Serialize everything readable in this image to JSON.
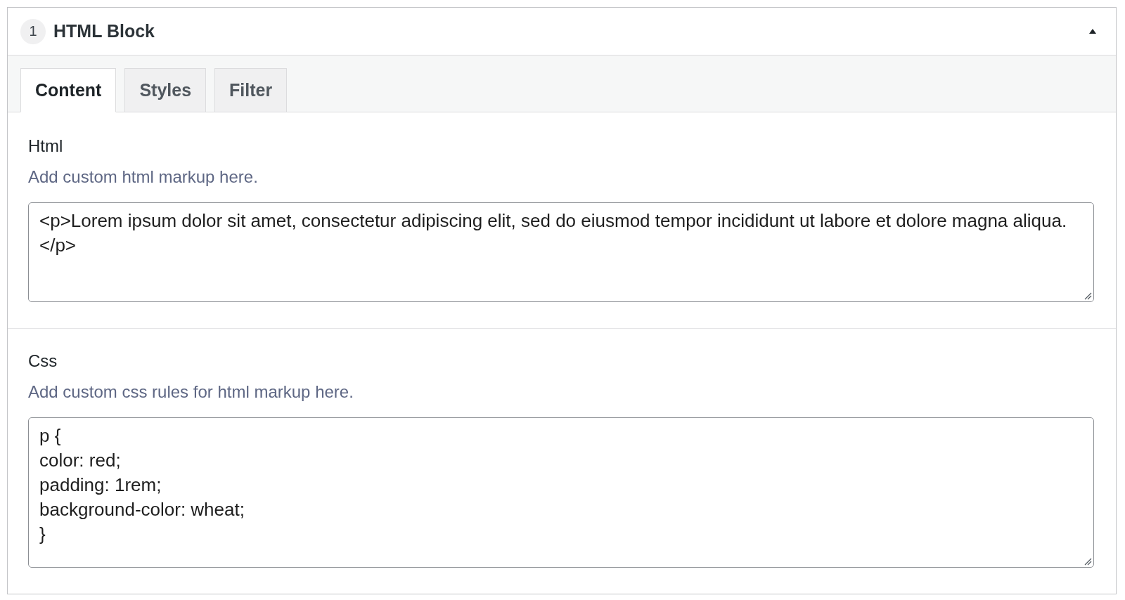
{
  "block": {
    "number": "1",
    "title": "HTML Block",
    "expanded": true,
    "tabs": [
      {
        "label": "Content",
        "selected": true
      },
      {
        "label": "Styles",
        "selected": false
      },
      {
        "label": "Filter",
        "selected": false
      }
    ],
    "fields": [
      {
        "label": "Html",
        "description": "Add custom html markup here.",
        "value": "<p>Lorem ipsum dolor sit amet, consectetur adipiscing elit, sed do eiusmod tempor incididunt ut labore et dolore magna aliqua.\n</p>"
      },
      {
        "label": "Css",
        "description": "Add custom css rules for html markup here.",
        "value": "p {\ncolor: red;\npadding: 1rem;\nbackground-color: wheat;\n}"
      }
    ]
  }
}
